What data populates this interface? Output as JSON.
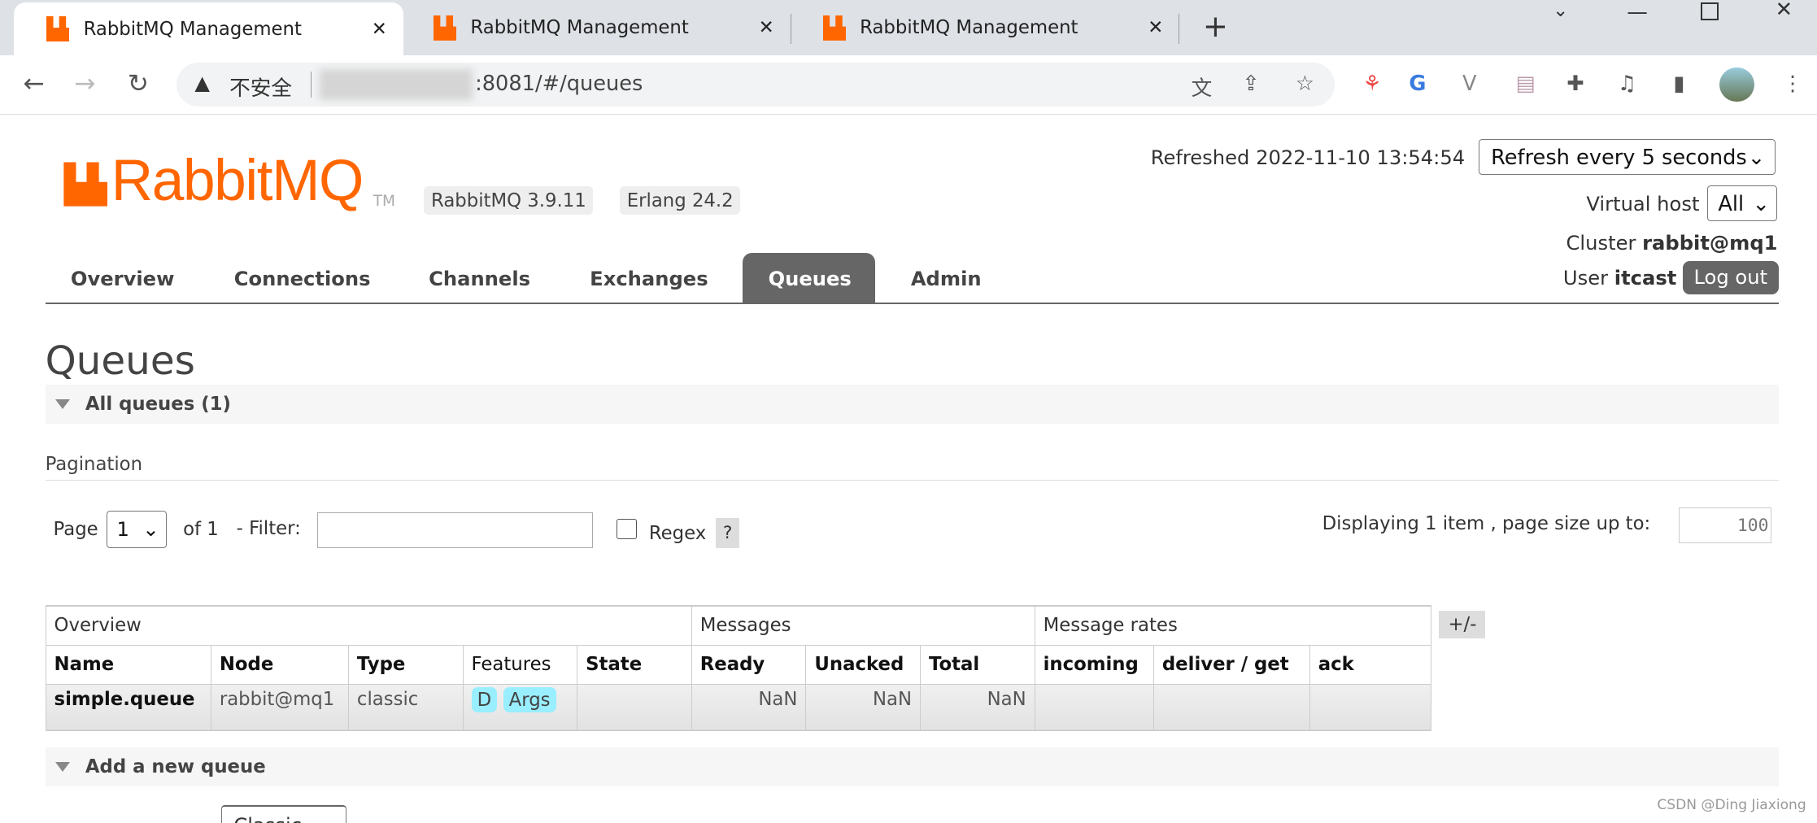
{
  "browser": {
    "tabs": [
      {
        "title": "RabbitMQ Management"
      },
      {
        "title": "RabbitMQ Management"
      },
      {
        "title": "RabbitMQ Management"
      }
    ],
    "security_label": "不安全",
    "url": ":8081/#/queues"
  },
  "header": {
    "logo_text": "RabbitMQ",
    "logo_tm": "TM",
    "version": "RabbitMQ 3.9.11",
    "erlang": "Erlang 24.2",
    "refreshed": "Refreshed 2022-11-10 13:54:54",
    "refresh_option": "Refresh every 5 seconds",
    "vhost_label": "Virtual host",
    "vhost_value": "All",
    "cluster_label": "Cluster",
    "cluster_value": "rabbit@mq1",
    "user_label": "User",
    "user_value": "itcast",
    "logout": "Log out"
  },
  "nav": [
    "Overview",
    "Connections",
    "Channels",
    "Exchanges",
    "Queues",
    "Admin"
  ],
  "page": {
    "title": "Queues",
    "all_queues": "All queues (1)",
    "pagination": "Pagination",
    "page_label": "Page",
    "page_value": "1",
    "of_label": "of 1",
    "filter_label": "- Filter:",
    "filter_value": "",
    "regex_label": "Regex",
    "help": "?",
    "displaying": "Displaying 1 item , page size up to:",
    "page_size": "100",
    "plus_minus": "+/-",
    "add_queue": "Add a new queue",
    "type_select": "Classic"
  },
  "table": {
    "groups": [
      "Overview",
      "Messages",
      "Message rates"
    ],
    "columns": [
      "Name",
      "Node",
      "Type",
      "Features",
      "State",
      "Ready",
      "Unacked",
      "Total",
      "incoming",
      "deliver / get",
      "ack"
    ],
    "rows": [
      {
        "name": "simple.queue",
        "node": "rabbit@mq1",
        "type": "classic",
        "features": [
          "D",
          "Args"
        ],
        "state": "",
        "ready": "NaN",
        "unacked": "NaN",
        "total": "NaN",
        "incoming": "",
        "deliver_get": "",
        "ack": ""
      }
    ]
  },
  "watermark": "CSDN @Ding Jiaxiong",
  "colors": {
    "brand": "#ff6600",
    "active_tab": "#666666",
    "feature_badge": "#99eeff"
  }
}
